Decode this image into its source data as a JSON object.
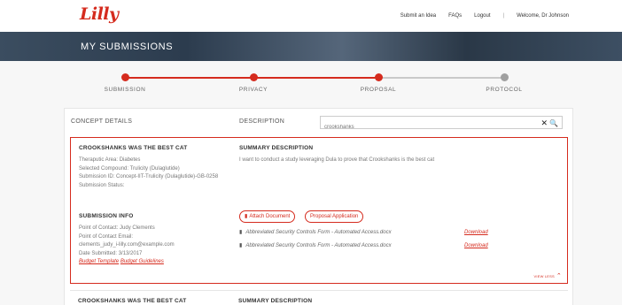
{
  "header": {
    "logo_text": "Lilly",
    "nav": {
      "submit_idea": "Submit an Idea",
      "faqs": "FAQs",
      "logout": "Logout",
      "separator": "|",
      "welcome": "Welcome, Dr Johnson"
    }
  },
  "hero": {
    "title": "MY SUBMISSIONS"
  },
  "stepper": {
    "steps": [
      {
        "label": "SUBMISSION",
        "state": "complete"
      },
      {
        "label": "PRIVACY",
        "state": "complete"
      },
      {
        "label": "PROPOSAL",
        "state": "complete"
      },
      {
        "label": "PROTOCOL",
        "state": "pending"
      }
    ]
  },
  "list_header": {
    "concept_details": "CONCEPT DETAILS",
    "description": "DESCRIPTION"
  },
  "search": {
    "value": "crookshanks",
    "clear_icon": "✕",
    "search_icon": "🔍"
  },
  "results": [
    {
      "title": "CROOKSHANKS WAS THE BEST CAT",
      "meta": {
        "therapeutic_area": "Theraputic Area: Diabetes",
        "compound": "Selected Compound: Trulicity (Dulaglutide)",
        "submission_id": "Submission ID: Concept-IIT-Trulicity (Dulaglutide)-GB-0258",
        "status": "Submission Status:"
      },
      "summary_header": "SUMMARY DESCRIPTION",
      "summary": "I want to conduct a study leveraging Dula to prove that Crookshanks is the best cat",
      "info_header": "SUBMISSION INFO",
      "info": {
        "contact": "Point of Contact: Judy Clements",
        "email_label": "Point of Contact Email:",
        "email": "clements_judy_i-lilly.com@example.com",
        "date": "Date Submitted: 3/13/2017",
        "budget_template": "Budget Template",
        "budget_guidelines": "Budget Guidelines"
      },
      "buttons": {
        "attach": "Attach Document",
        "proposal": "Proposal Application"
      },
      "documents": [
        {
          "name": "Abbreviated Security Controls Form - Automated Access.docx",
          "action": "Download"
        },
        {
          "name": "Abbreviated Security Controls Form - Automated Access.docx",
          "action": "Download"
        }
      ],
      "view_less": "VIEW LESS"
    },
    {
      "title": "CROOKSHANKS WAS THE BEST CAT",
      "summary_header": "SUMMARY DESCRIPTION"
    }
  ],
  "colors": {
    "accent": "#d52b1e",
    "step_pending": "#a0a0a0"
  }
}
